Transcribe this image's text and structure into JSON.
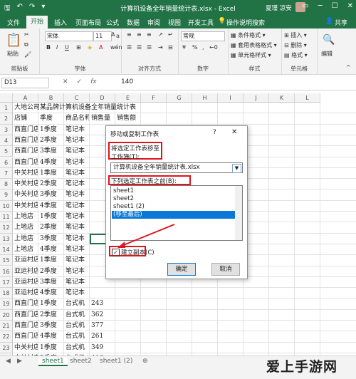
{
  "title_bar": {
    "title": "计算机设备全年销量统计表.xlsx - Excel",
    "user": "夏瑾 凉安"
  },
  "ribbon_tabs": [
    "文件",
    "开始",
    "插入",
    "页面布局",
    "公式",
    "数据",
    "审阅",
    "视图",
    "开发工具",
    "操作说明搜索"
  ],
  "ribbon_share": "共享",
  "ribbon": {
    "clipboard": {
      "paste": "粘贴",
      "group": "剪贴板"
    },
    "font": {
      "font_name": "宋体",
      "font_size": "11",
      "group": "字体",
      "wen": "wén"
    },
    "alignment": {
      "group": "对齐方式"
    },
    "number": {
      "format": "常规",
      "group": "数字"
    },
    "styles": {
      "cond": "条件格式 ▾",
      "table": "套用表格格式 ▾",
      "cell": "单元格样式 ▾",
      "group": "样式"
    },
    "cells": {
      "insert": "插入 ▾",
      "delete": "删除 ▾",
      "format": "格式 ▾",
      "group": "单元格"
    },
    "editing": {
      "label": "编辑"
    }
  },
  "formula_bar": {
    "name_box": "D13",
    "value": "140"
  },
  "columns": [
    "A",
    "B",
    "C",
    "D",
    "E",
    "F",
    "G",
    "H",
    "I",
    "J",
    "K",
    "L"
  ],
  "sheet": {
    "title": "大地公司某品牌计算机设备全年销量统计表",
    "headers": [
      "店铺",
      "季度",
      "商品名称",
      "销售量",
      "销售额"
    ],
    "rows": [
      [
        "西直门店",
        "1季度",
        "笔记本",
        "",
        ""
      ],
      [
        "西直门店",
        "2季度",
        "笔记本",
        "",
        ""
      ],
      [
        "西直门店",
        "3季度",
        "笔记本",
        "",
        ""
      ],
      [
        "西直门店",
        "4季度",
        "笔记本",
        "",
        ""
      ],
      [
        "中关村店",
        "1季度",
        "笔记本",
        "",
        ""
      ],
      [
        "中关村店",
        "2季度",
        "笔记本",
        "",
        ""
      ],
      [
        "中关村店",
        "3季度",
        "笔记本",
        "",
        ""
      ],
      [
        "中关村店",
        "4季度",
        "笔记本",
        "",
        ""
      ],
      [
        "上地店",
        "1季度",
        "笔记本",
        "",
        ""
      ],
      [
        "上地店",
        "2季度",
        "笔记本",
        "",
        ""
      ],
      [
        "上地店",
        "3季度",
        "笔记本",
        "",
        ""
      ],
      [
        "上地店",
        "4季度",
        "笔记本",
        "",
        ""
      ],
      [
        "亚运村店",
        "1季度",
        "笔记本",
        "",
        ""
      ],
      [
        "亚运村店",
        "2季度",
        "笔记本",
        "",
        ""
      ],
      [
        "亚运村店",
        "3季度",
        "笔记本",
        "",
        ""
      ],
      [
        "亚运村店",
        "4季度",
        "笔记本",
        "",
        ""
      ],
      [
        "西直门店",
        "1季度",
        "台式机",
        "243",
        ""
      ],
      [
        "西直门店",
        "2季度",
        "台式机",
        "362",
        ""
      ],
      [
        "西直门店",
        "3季度",
        "台式机",
        "377",
        ""
      ],
      [
        "西直门店",
        "4季度",
        "台式机",
        "261",
        ""
      ],
      [
        "中关村店",
        "1季度",
        "台式机",
        "349",
        ""
      ],
      [
        "中关村店",
        "2季度",
        "台式机",
        "416",
        ""
      ],
      [
        "中关村店",
        "3季度",
        "台式机",
        "247",
        ""
      ]
    ]
  },
  "sheet_tabs": [
    "sheet1",
    "sheet2",
    "sheet1 (2)"
  ],
  "dialog": {
    "title": "移动或复制工作表",
    "help": "?",
    "close": "✕",
    "move_label": "将选定工作表移至",
    "workbook_label": "工作簿(T):",
    "workbook_value": "计算机设备全年销量统计表.xlsx",
    "before_label": "下列选定工作表之前(B):",
    "list": [
      "sheet1",
      "sheet2",
      "sheet1 (2)",
      "(移至最后)"
    ],
    "selected_index": 3,
    "copy_label": "建立副本(C)",
    "copy_checked": true,
    "ok": "确定",
    "cancel": "取消"
  },
  "watermark": "爱上手游网",
  "colors": {
    "excel_green": "#217346",
    "highlight_red": "#e0141e",
    "selection_blue": "#0a78d7"
  }
}
